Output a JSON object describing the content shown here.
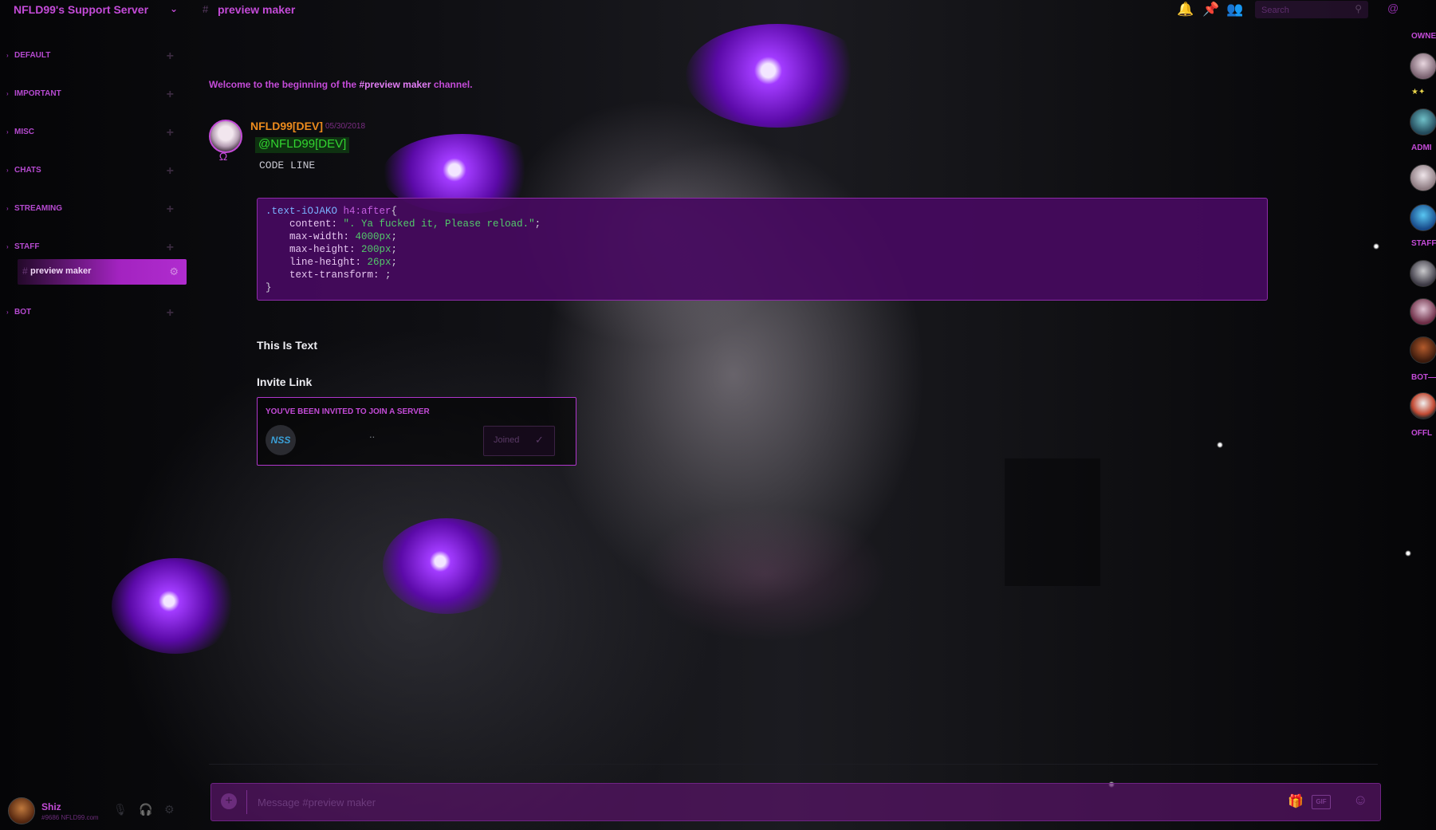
{
  "server": {
    "name": "NFLD99's Support Server"
  },
  "categories": [
    {
      "label": "DEFAULT"
    },
    {
      "label": "IMPORTANT"
    },
    {
      "label": "MISC"
    },
    {
      "label": "CHATS"
    },
    {
      "label": "STREAMING"
    },
    {
      "label": "STAFF"
    },
    {
      "label": "BOT"
    }
  ],
  "active_channel": {
    "name": "preview maker"
  },
  "user": {
    "name": "Shiz",
    "tag": "#9686 NFLD99.com"
  },
  "header": {
    "channel_title": "preview maker",
    "search_placeholder": "Search"
  },
  "welcome": {
    "prefix": "Welcome to the beginning of the ",
    "channel": "#preview maker",
    "suffix": " channel."
  },
  "message": {
    "author": "NFLD99[DEV]",
    "timestamp": "05/30/2018",
    "mention": "@NFLD99[DEV]",
    "code_line": "CODE LINE"
  },
  "code_block": {
    "selector": ".text-iOJAKO",
    "tag": " h4:after",
    "open_brace": "{",
    "lines": [
      {
        "prop": "    content: ",
        "value": "\". Ya fucked it, Please reload.\"",
        "end": ";"
      },
      {
        "prop": "    max-width: ",
        "value": "4000px",
        "end": ";"
      },
      {
        "prop": "    max-height: ",
        "value": "200px",
        "end": ";"
      },
      {
        "prop": "    line-height: ",
        "value": "26px",
        "end": ";"
      },
      {
        "prop": "    text-transform: ",
        "value": "",
        "end": ";"
      }
    ],
    "close_brace": "}"
  },
  "headings": {
    "text": "This Is Text",
    "invite": "Invite Link"
  },
  "invite": {
    "title": "YOU'VE BEEN INVITED TO JOIN A SERVER",
    "server_abbrev": "NSS",
    "server_name": "..",
    "button_label": "Joined"
  },
  "composer": {
    "placeholder": "Message #preview maker"
  },
  "members": {
    "headers": [
      "OWNE",
      "★✦",
      "ADMI",
      "STAFF",
      "BOT—",
      "OFFL"
    ]
  },
  "colors": {
    "accent": "#c44bd8",
    "author": "#ec8b1d",
    "mention": "#32d630",
    "code_bg": "#460a5f"
  }
}
